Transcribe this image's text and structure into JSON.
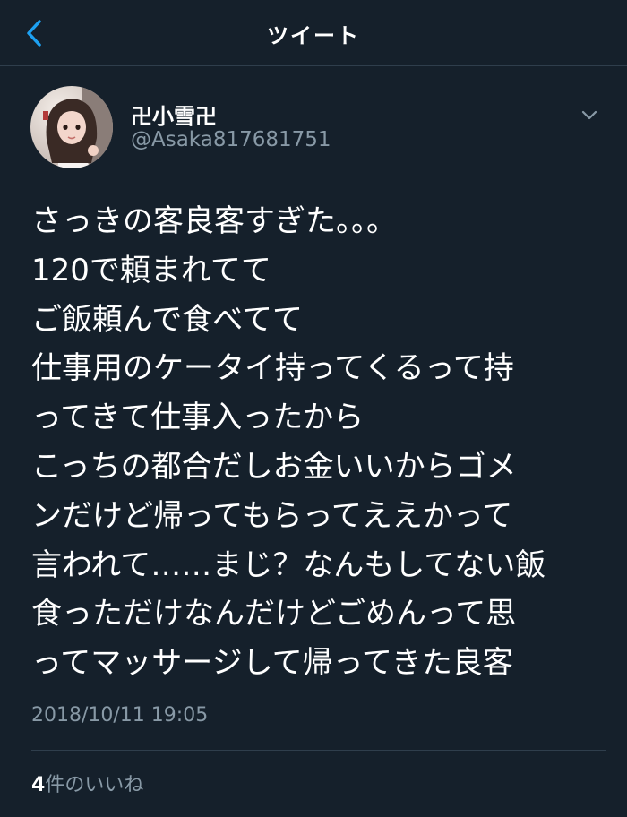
{
  "header": {
    "title": "ツイート",
    "back_icon": "chevron-left-icon"
  },
  "colors": {
    "background": "#15202b",
    "accent": "#1da1f2",
    "secondary_text": "#8899a6",
    "divider": "#2f3e4c"
  },
  "tweet": {
    "author": {
      "display_name": "卍小雪卍",
      "handle": "@Asaka817681751"
    },
    "more_icon": "chevron-down-icon",
    "lines": [
      "さっきの客良客すぎた。。。",
      "120で頼まれてて",
      "ご飯頼んで食べてて",
      "仕事用のケータイ持ってくるって持",
      "ってきて仕事入ったから",
      "こっちの都合だしお金いいからゴメ",
      "ンだけど帰ってもらってええかって",
      "言われて……まじ？なんもしてない飯",
      "食っただけなんだけどごめんって思",
      "ってマッサージして帰ってきた良客"
    ],
    "timestamp": "2018/10/11 19:05",
    "likes": {
      "count": "4",
      "label": "件のいいね"
    }
  }
}
